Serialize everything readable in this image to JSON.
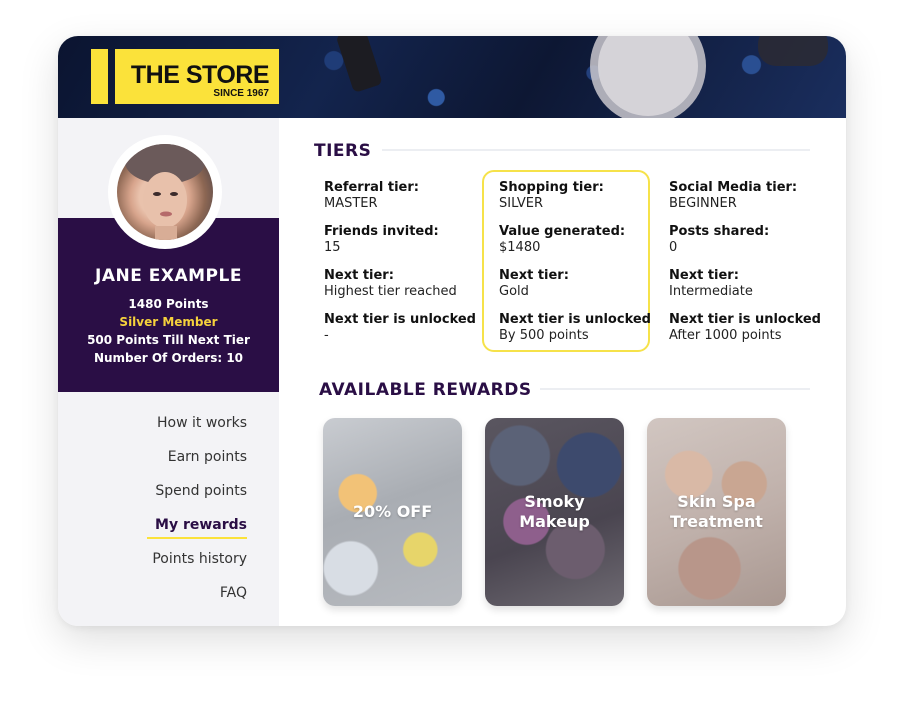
{
  "brand": {
    "name": "THE STORE",
    "tagline": "SINCE 1967",
    "accent": "#fbe23a",
    "primary": "#2a0e45"
  },
  "profile": {
    "name": "JANE EXAMPLE",
    "points": "1480  Points",
    "member": "Silver Member",
    "till_next": "500 Points Till Next Tier",
    "orders": "Number Of Orders: 10"
  },
  "nav": [
    {
      "label": "How it works"
    },
    {
      "label": "Earn points"
    },
    {
      "label": "Spend points"
    },
    {
      "label": "My rewards",
      "active": true
    },
    {
      "label": "Points history"
    },
    {
      "label": "FAQ"
    }
  ],
  "tiers": {
    "title": "TIERS",
    "columns": [
      {
        "tier_label": "Referral tier:",
        "tier_value": "MASTER",
        "metric_label": "Friends invited:",
        "metric_value": "15",
        "next_label": "Next tier:",
        "next_value": "Highest tier reached",
        "unlock_label": "Next tier is unlocked",
        "unlock_value": "-"
      },
      {
        "tier_label": "Shopping tier:",
        "tier_value": "SILVER",
        "metric_label": "Value generated:",
        "metric_value": "$1480",
        "next_label": "Next tier:",
        "next_value": "Gold",
        "unlock_label": "Next tier is unlocked",
        "unlock_value": "By 500 points"
      },
      {
        "tier_label": "Social Media tier:",
        "tier_value": "BEGINNER",
        "metric_label": "Posts shared:",
        "metric_value": "0",
        "next_label": "Next tier:",
        "next_value": "Intermediate",
        "unlock_label": "Next tier is unlocked",
        "unlock_value": "After 1000 points"
      }
    ]
  },
  "rewards": {
    "title": "AVAILABLE REWARDS",
    "items": [
      {
        "label": "20% OFF"
      },
      {
        "label": "Smoky Makeup"
      },
      {
        "label": "Skin Spa Treatment"
      }
    ]
  }
}
